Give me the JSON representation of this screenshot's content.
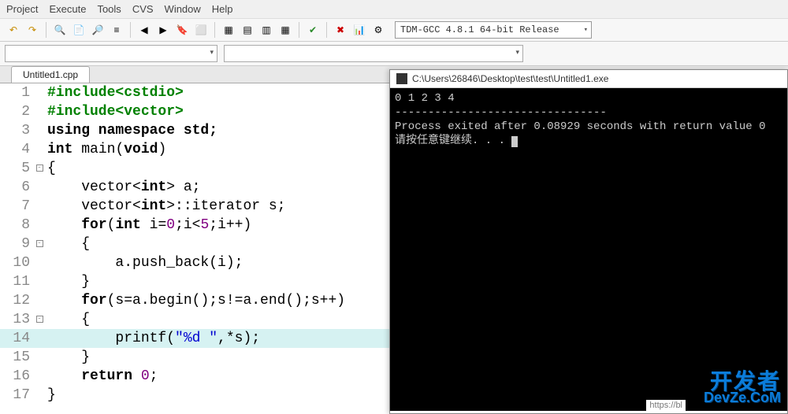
{
  "menu": [
    "Project",
    "Execute",
    "Tools",
    "CVS",
    "Window",
    "Help"
  ],
  "compiler_selection": "TDM-GCC 4.8.1 64-bit Release",
  "tab_title": "Untitled1.cpp",
  "code_lines": [
    {
      "n": 1,
      "fold": "",
      "segs": [
        {
          "t": "#include<cstdio>",
          "c": "kw-pp"
        }
      ]
    },
    {
      "n": 2,
      "fold": "",
      "segs": [
        {
          "t": "#include<vector>",
          "c": "kw-pp"
        }
      ]
    },
    {
      "n": 3,
      "fold": "",
      "segs": [
        {
          "t": "using namespace std;",
          "c": "kw"
        }
      ]
    },
    {
      "n": 4,
      "fold": "",
      "segs": [
        {
          "t": "int ",
          "c": "type"
        },
        {
          "t": "main",
          "c": "plain"
        },
        {
          "t": "(",
          "c": "plain"
        },
        {
          "t": "void",
          "c": "kw"
        },
        {
          "t": ")",
          "c": "plain"
        }
      ]
    },
    {
      "n": 5,
      "fold": "box",
      "segs": [
        {
          "t": "{",
          "c": "plain"
        }
      ]
    },
    {
      "n": 6,
      "fold": "",
      "segs": [
        {
          "t": "    vector<",
          "c": "plain"
        },
        {
          "t": "int",
          "c": "type"
        },
        {
          "t": "> a;",
          "c": "plain"
        }
      ]
    },
    {
      "n": 7,
      "fold": "",
      "segs": [
        {
          "t": "    vector<",
          "c": "plain"
        },
        {
          "t": "int",
          "c": "type"
        },
        {
          "t": ">::iterator s;",
          "c": "plain"
        }
      ]
    },
    {
      "n": 8,
      "fold": "",
      "segs": [
        {
          "t": "    ",
          "c": "plain"
        },
        {
          "t": "for",
          "c": "kw"
        },
        {
          "t": "(",
          "c": "plain"
        },
        {
          "t": "int",
          "c": "type"
        },
        {
          "t": " i=",
          "c": "plain"
        },
        {
          "t": "0",
          "c": "num"
        },
        {
          "t": ";i<",
          "c": "plain"
        },
        {
          "t": "5",
          "c": "num"
        },
        {
          "t": ";i++)",
          "c": "plain"
        }
      ]
    },
    {
      "n": 9,
      "fold": "box",
      "segs": [
        {
          "t": "    {",
          "c": "plain"
        }
      ]
    },
    {
      "n": 10,
      "fold": "",
      "segs": [
        {
          "t": "        a.push_back(i);",
          "c": "plain"
        }
      ]
    },
    {
      "n": 11,
      "fold": "",
      "segs": [
        {
          "t": "    }",
          "c": "plain"
        }
      ]
    },
    {
      "n": 12,
      "fold": "",
      "segs": [
        {
          "t": "    ",
          "c": "plain"
        },
        {
          "t": "for",
          "c": "kw"
        },
        {
          "t": "(s=a.begin();s!=a.end();s++)",
          "c": "plain"
        }
      ]
    },
    {
      "n": 13,
      "fold": "box",
      "segs": [
        {
          "t": "    {",
          "c": "plain"
        }
      ]
    },
    {
      "n": 14,
      "fold": "",
      "hl": true,
      "segs": [
        {
          "t": "        printf(",
          "c": "plain"
        },
        {
          "t": "\"%d \"",
          "c": "str"
        },
        {
          "t": ",*s);",
          "c": "plain"
        }
      ]
    },
    {
      "n": 15,
      "fold": "",
      "segs": [
        {
          "t": "    }",
          "c": "plain"
        }
      ]
    },
    {
      "n": 16,
      "fold": "",
      "segs": [
        {
          "t": "    ",
          "c": "plain"
        },
        {
          "t": "return ",
          "c": "kw"
        },
        {
          "t": "0",
          "c": "num"
        },
        {
          "t": ";",
          "c": "plain"
        }
      ]
    },
    {
      "n": 17,
      "fold": "",
      "segs": [
        {
          "t": "}",
          "c": "plain"
        }
      ]
    }
  ],
  "console": {
    "title": "C:\\Users\\26846\\Desktop\\test\\test\\Untitled1.exe",
    "output_line": "0 1 2 3 4",
    "divider": "--------------------------------",
    "process_line": "Process exited after 0.08929 seconds with return value 0",
    "prompt_line": "请按任意键继续. . . "
  },
  "watermark": {
    "cn": "开发者",
    "en": "DevZe.CoM"
  },
  "footer_url": "https://bl",
  "toolbar_icons": [
    "undo-icon",
    "redo-icon",
    "search-icon",
    "search-in-files-icon",
    "find-replace-icon",
    "goto-icon",
    "prev-icon",
    "next-icon",
    "bookmark-icon",
    "stop-icon",
    "layout1-icon",
    "layout2-icon",
    "layout3-icon",
    "layout4-icon",
    "check-icon",
    "close-red-icon",
    "chart-icon",
    "profile-icon"
  ],
  "toolbar_glyphs": [
    "↶",
    "↷",
    "🔍",
    "📄",
    "🔎",
    "≡",
    "◀",
    "▶",
    "🔖",
    "⬜",
    "▦",
    "▤",
    "▥",
    "▦",
    "✔",
    "✖",
    "📊",
    "⚙"
  ]
}
